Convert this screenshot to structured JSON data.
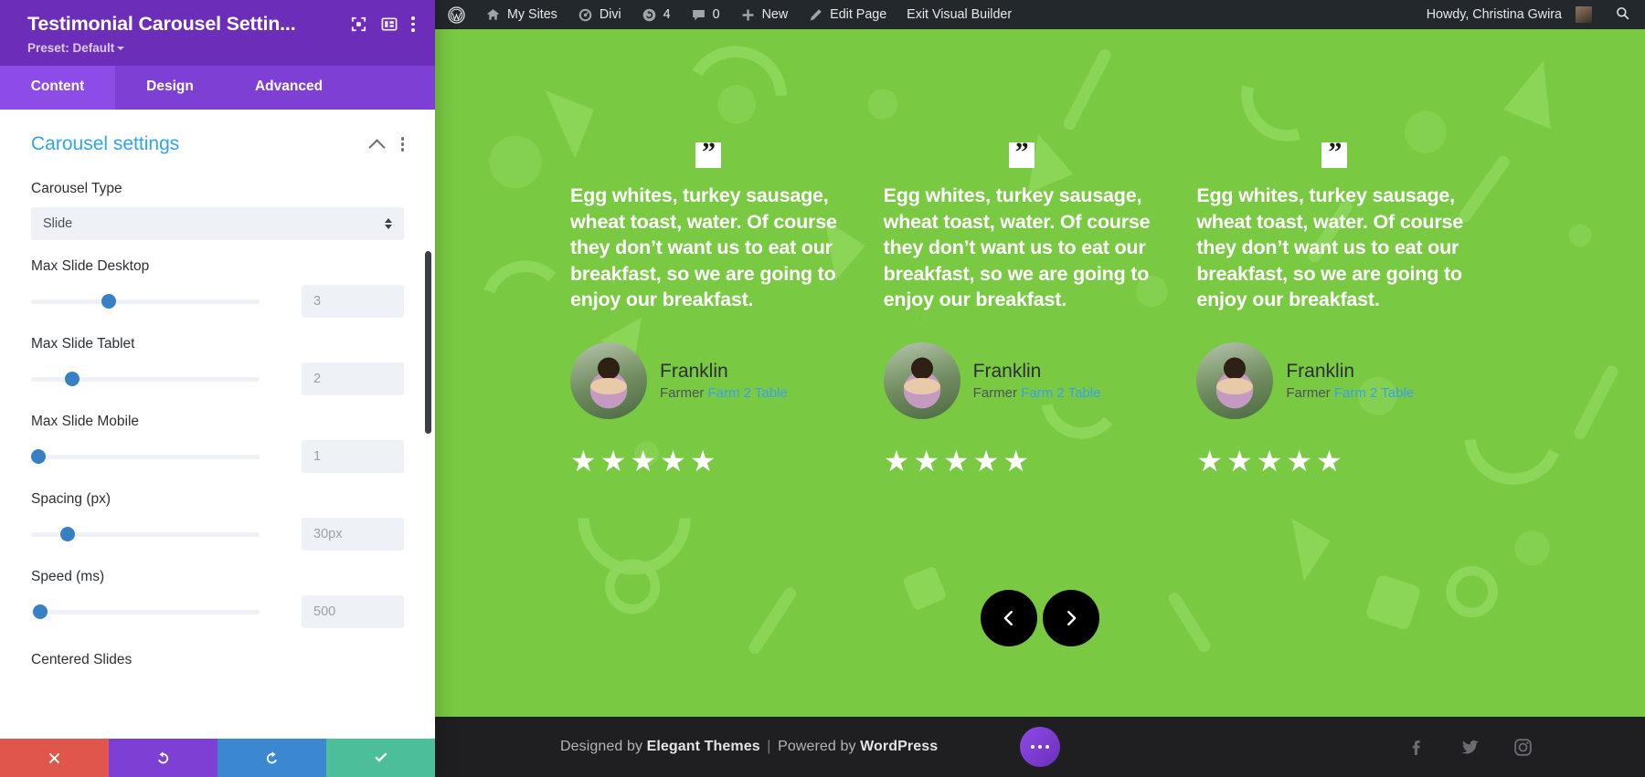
{
  "settings_panel": {
    "title": "Testimonial Carousel Settin...",
    "preset": "Preset: Default",
    "icons": {
      "focus": "focus-target-icon",
      "layout": "layout-columns-icon",
      "more": "kebab-menu-icon"
    },
    "tabs": [
      {
        "label": "Content",
        "active": true
      },
      {
        "label": "Design",
        "active": false
      },
      {
        "label": "Advanced",
        "active": false
      }
    ],
    "section": {
      "title": "Carousel settings",
      "collapse_icon": "chevron-up-icon",
      "menu_icon": "kebab-menu-icon"
    },
    "fields": {
      "carousel_type": {
        "label": "Carousel Type",
        "value": "Slide"
      },
      "max_slide_desktop": {
        "label": "Max Slide Desktop",
        "value": "3",
        "knob_pct": 34
      },
      "max_slide_tablet": {
        "label": "Max Slide Tablet",
        "value": "2",
        "knob_pct": 18
      },
      "max_slide_mobile": {
        "label": "Max Slide Mobile",
        "value": "1",
        "knob_pct": 3
      },
      "spacing": {
        "label": "Spacing (px)",
        "value": "30px",
        "knob_pct": 16
      },
      "speed": {
        "label": "Speed (ms)",
        "value": "500",
        "knob_pct": 4
      },
      "centered_slides": {
        "label": "Centered Slides"
      }
    },
    "footer_buttons": [
      {
        "name": "discard",
        "icon": "close-x-icon",
        "color": "#e0564c"
      },
      {
        "name": "undo",
        "icon": "undo-arrow-icon",
        "color": "#7e3fd4"
      },
      {
        "name": "redo",
        "icon": "redo-arrow-icon",
        "color": "#3b88d0"
      },
      {
        "name": "save",
        "icon": "checkmark-icon",
        "color": "#4cbf9a"
      }
    ]
  },
  "admin_bar": {
    "wp_logo": "wordpress-logo-icon",
    "items": [
      {
        "label": "My Sites",
        "icon": "site-buildings-icon"
      },
      {
        "label": "Divi",
        "icon": "dashboard-gauge-icon"
      },
      {
        "label": "4",
        "icon": "updates-refresh-icon"
      },
      {
        "label": "0",
        "icon": "comment-bubble-icon"
      },
      {
        "label": "New",
        "icon": "plus-icon"
      },
      {
        "label": "Edit Page",
        "icon": "pencil-icon"
      },
      {
        "label": "Exit Visual Builder",
        "icon": ""
      }
    ],
    "account": {
      "greeting": "Howdy, Christina Gwira",
      "avatar": "user-avatar"
    },
    "search_icon": "search-icon"
  },
  "stage": {
    "background_color": "#7ac943",
    "quote_mark": "”",
    "cards": [
      {
        "text": "Egg whites, turkey sausage, wheat toast, water. Of course they don’t want us to eat our breakfast, so we are going to enjoy our breakfast.",
        "name": "Franklin",
        "role": "Farmer",
        "company": "Farm 2 Table",
        "rating": 5
      },
      {
        "text": "Egg whites, turkey sausage, wheat toast, water. Of course they don’t want us to eat our breakfast, so we are going to enjoy our breakfast.",
        "name": "Franklin",
        "role": "Farmer",
        "company": "Farm 2 Table",
        "rating": 5
      },
      {
        "text": "Egg whites, turkey sausage, wheat toast, water. Of course they don’t want us to eat our breakfast, so we are going to enjoy our breakfast.",
        "name": "Franklin",
        "role": "Farmer",
        "company": "Farm 2 Table",
        "rating": 5
      }
    ],
    "nav": {
      "prev_icon": "chevron-left-icon",
      "next_icon": "chevron-right-icon"
    }
  },
  "site_footer": {
    "credit_prefix": "Designed by",
    "credit_brand": "Elegant Themes",
    "separator": "|",
    "credit_suffix": "Powered by",
    "credit_platform": "WordPress",
    "fab_icon": "ellipsis-icon",
    "social": [
      {
        "name": "facebook-icon"
      },
      {
        "name": "twitter-icon"
      },
      {
        "name": "instagram-icon"
      }
    ]
  },
  "colors": {
    "panel_header": "#6c2eb9",
    "panel_tabs": "#7e3fd4",
    "accent_blue": "#2ea3f2",
    "stage_green": "#7ac943",
    "admin_bar": "#23282d"
  }
}
